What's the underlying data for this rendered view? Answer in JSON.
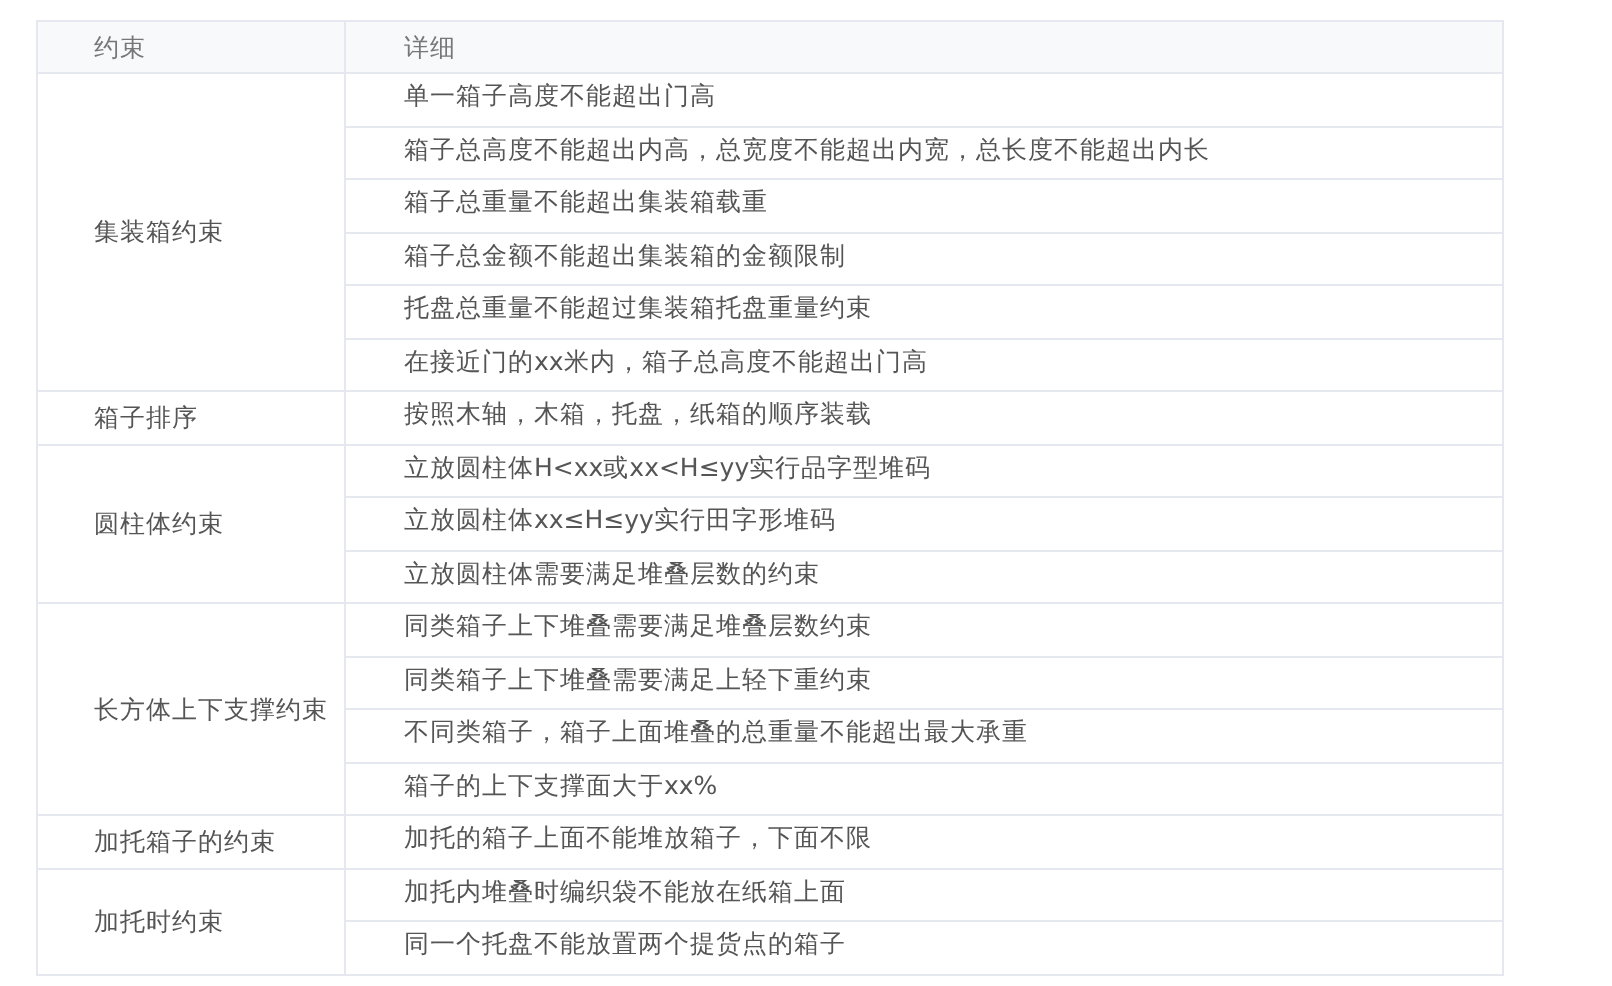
{
  "table": {
    "columns": [
      "约束",
      "详细"
    ],
    "groups": [
      {
        "constraint": "集装箱约束",
        "details": [
          "单一箱子高度不能超出门高",
          "箱子总高度不能超出内高，总宽度不能超出内宽，总长度不能超出内长",
          "箱子总重量不能超出集装箱载重",
          "箱子总金额不能超出集装箱的金额限制",
          "托盘总重量不能超过集装箱托盘重量约束",
          "在接近门的xx米内，箱子总高度不能超出门高"
        ]
      },
      {
        "constraint": "箱子排序",
        "details": [
          "按照木轴，木箱，托盘，纸箱的顺序装载"
        ]
      },
      {
        "constraint": "圆柱体约束",
        "details": [
          "立放圆柱体H<xx或xx<H≤yy实行品字型堆码",
          "立放圆柱体xx≤H≤yy实行田字形堆码",
          "立放圆柱体需要满足堆叠层数的约束"
        ]
      },
      {
        "constraint": "长方体上下支撑约束",
        "details": [
          "同类箱子上下堆叠需要满足堆叠层数约束",
          "同类箱子上下堆叠需要满足上轻下重约束",
          "不同类箱子，箱子上面堆叠的总重量不能超出最大承重",
          "箱子的上下支撑面大于xx%"
        ]
      },
      {
        "constraint": "加托箱子的约束",
        "details": [
          "加托的箱子上面不能堆放箱子，下面不限"
        ]
      },
      {
        "constraint": "加托时约束",
        "details": [
          "加托内堆叠时编织袋不能放在纸箱上面",
          "同一个托盘不能放置两个提货点的箱子"
        ]
      }
    ]
  }
}
